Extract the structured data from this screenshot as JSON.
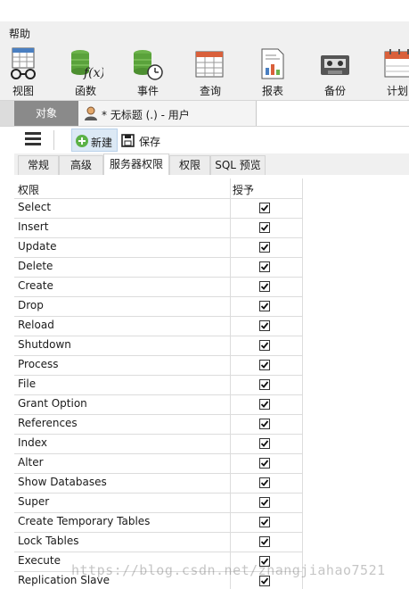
{
  "menu": {
    "help": "帮助"
  },
  "toolbar": [
    {
      "label": "视图",
      "icon": "view-icon"
    },
    {
      "label": "函数",
      "icon": "function-icon"
    },
    {
      "label": "事件",
      "icon": "event-icon"
    },
    {
      "label": "查询",
      "icon": "query-icon"
    },
    {
      "label": "报表",
      "icon": "report-icon"
    },
    {
      "label": "备份",
      "icon": "backup-icon"
    },
    {
      "label": "计划",
      "icon": "schedule-icon"
    }
  ],
  "tabs": {
    "objects": "对象",
    "document": "* 无标题 (.) - 用户"
  },
  "subtoolbar": {
    "new": "新建",
    "save": "保存"
  },
  "subtabs": [
    "常规",
    "高级",
    "服务器权限",
    "权限",
    "SQL 预览"
  ],
  "active_subtab": "服务器权限",
  "grid": {
    "col_privilege": "权限",
    "col_grant": "授予",
    "rows": [
      {
        "name": "Select",
        "granted": true
      },
      {
        "name": "Insert",
        "granted": true
      },
      {
        "name": "Update",
        "granted": true
      },
      {
        "name": "Delete",
        "granted": true
      },
      {
        "name": "Create",
        "granted": true
      },
      {
        "name": "Drop",
        "granted": true
      },
      {
        "name": "Reload",
        "granted": true
      },
      {
        "name": "Shutdown",
        "granted": true
      },
      {
        "name": "Process",
        "granted": true
      },
      {
        "name": "File",
        "granted": true
      },
      {
        "name": "Grant Option",
        "granted": true
      },
      {
        "name": "References",
        "granted": true
      },
      {
        "name": "Index",
        "granted": true
      },
      {
        "name": "Alter",
        "granted": true
      },
      {
        "name": "Show Databases",
        "granted": true
      },
      {
        "name": "Super",
        "granted": true
      },
      {
        "name": "Create Temporary Tables",
        "granted": true
      },
      {
        "name": "Lock Tables",
        "granted": true
      },
      {
        "name": "Execute",
        "granted": true
      },
      {
        "name": "Replication Slave",
        "granted": true
      }
    ]
  },
  "watermark": "https://blog.csdn.net/zhangjiahao7521",
  "colors": {
    "accent": "#3c8fd8",
    "objects_tab": "#8a8a8a",
    "grid_line": "#dcdcdc"
  }
}
